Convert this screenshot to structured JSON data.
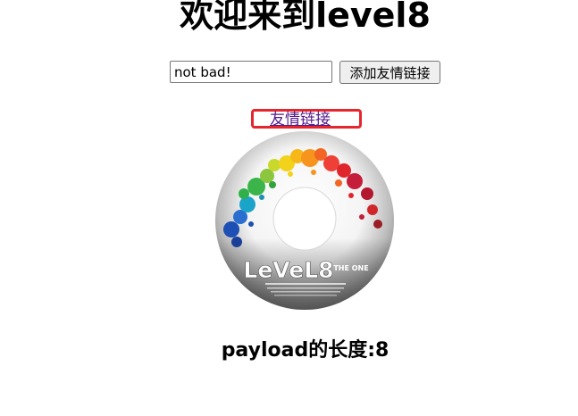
{
  "header": {
    "title": "欢迎来到level8"
  },
  "form": {
    "input_value": "not bad!",
    "submit_label": "添加友情链接"
  },
  "friend_link": {
    "label": "友情链接",
    "highlight_color": "#e5262d"
  },
  "banner_image": {
    "logo_text": "LeVeL8",
    "logo_suffix": "THE ONE"
  },
  "footer": {
    "payload_length_text": "payload的长度:8"
  }
}
